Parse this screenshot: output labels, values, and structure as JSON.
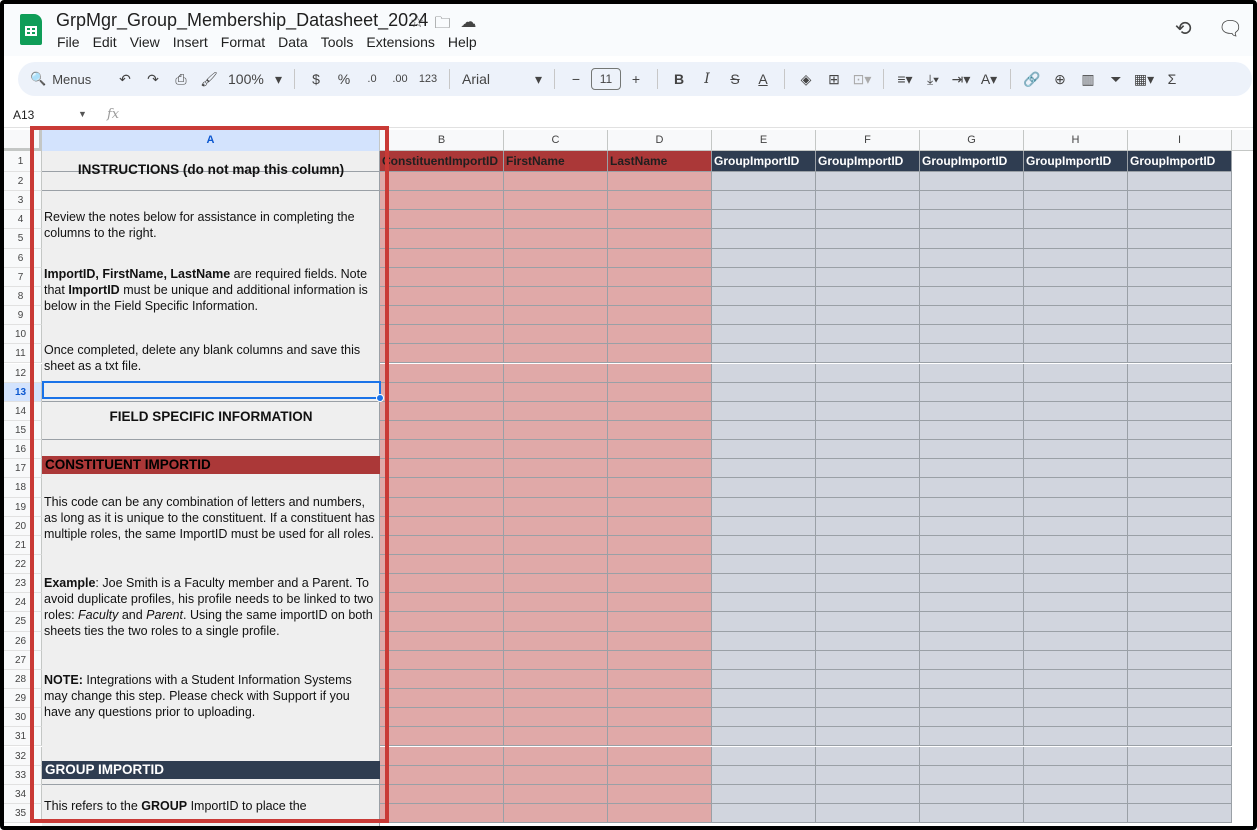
{
  "window": {
    "doc_title": "GrpMgr_Group_Membership_Datasheet_2024",
    "menu": [
      "File",
      "Edit",
      "View",
      "Insert",
      "Format",
      "Data",
      "Tools",
      "Extensions",
      "Help"
    ]
  },
  "toolbar": {
    "menus_label": "Menus",
    "zoom": "100%",
    "currency": "$",
    "percent": "%",
    "dec_decrease": ".0",
    "dec_increase": ".00",
    "number_format": "123",
    "font": "Arial",
    "font_size": "11"
  },
  "formula_bar": {
    "name_box": "A13",
    "fx": "fx",
    "value": ""
  },
  "columns": [
    "A",
    "B",
    "C",
    "D",
    "E",
    "F",
    "G",
    "H",
    "I"
  ],
  "rows": [
    "1",
    "2",
    "3",
    "4",
    "5",
    "6",
    "7",
    "8",
    "9",
    "10",
    "11",
    "12",
    "13",
    "14",
    "15",
    "16",
    "17",
    "18",
    "19",
    "20",
    "21",
    "22",
    "23",
    "24",
    "25",
    "26",
    "27",
    "28",
    "29",
    "30",
    "31",
    "32",
    "33",
    "34",
    "35"
  ],
  "header_row": {
    "B": "ConstituentImportID",
    "C": "FirstName",
    "D": "LastName",
    "E": "GroupImportID",
    "F": "GroupImportID",
    "G": "GroupImportID",
    "H": "GroupImportID",
    "I": "GroupImportID"
  },
  "instructions": {
    "title": "INSTRUCTIONS (do not map this column)",
    "p1": "Review the notes below for assistance in completing the columns to the right.",
    "p2_bold": "ImportID, FirstName, LastName",
    "p2_rest1": " are required fields. Note that ",
    "p2_bold2": "ImportID",
    "p2_rest2": " must be unique and additional information is below in the Field Specific Information.",
    "p3": "Once completed, delete any blank columns  and save this sheet as a txt file.",
    "field_title": "FIELD SPECIFIC INFORMATION",
    "constituent_header": "CONSTITUENT IMPORTID",
    "c1": "This code can be any combination of letters and numbers, as long as it is unique to the constituent. If a constituent has multiple roles, the same ImportID must be used for all roles.",
    "ex_bold": "Example",
    "ex_1": ": Joe Smith is a Faculty member and a Parent. To avoid duplicate profiles, his profile needs to be linked to two roles: ",
    "ex_fac": "Faculty",
    "ex_and": " and ",
    "ex_par": "Parent",
    "ex_2": ". Using the same importID on both sheets ties the two roles to a single profile.",
    "note_bold": "NOTE:",
    "note_rest": " Integrations with a Student Information Systems may change this step. Please check with Support if you have any questions prior to uploading.",
    "group_header": "GROUP IMPORTID",
    "g1_a": "This refers to the ",
    "g1_bold": "GROUP",
    "g1_b": " ImportID to place the"
  },
  "colors": {
    "pink": "#e0a9a8",
    "red_header": "#ab3838",
    "blue": "#d1d5de",
    "navy_header": "#2f3d51",
    "highlight_box": "#c93a36"
  }
}
